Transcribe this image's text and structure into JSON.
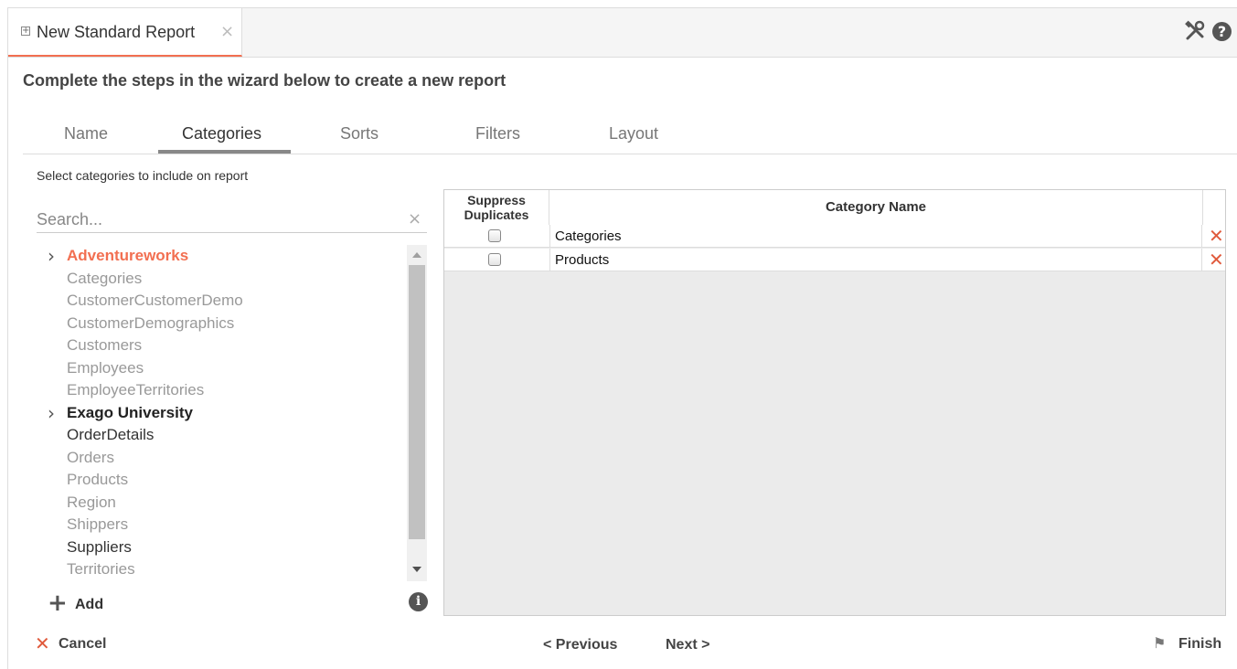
{
  "tab": {
    "title": "New Standard Report",
    "close": "×",
    "expand": "+"
  },
  "instructions": "Complete the steps in the wizard below to create a new report",
  "steps": [
    {
      "label": "Name",
      "active": false
    },
    {
      "label": "Categories",
      "active": true
    },
    {
      "label": "Sorts",
      "active": false
    },
    {
      "label": "Filters",
      "active": false
    },
    {
      "label": "Layout",
      "active": false
    }
  ],
  "select_label": "Select categories to include on report",
  "search": {
    "placeholder": "Search...",
    "clear": "×"
  },
  "tree": [
    {
      "label": "Adventureworks",
      "type": "group",
      "color": "#f26f51"
    },
    {
      "label": "Categories",
      "type": "item",
      "color": "#999999"
    },
    {
      "label": "CustomerCustomerDemo",
      "type": "item",
      "color": "#999999"
    },
    {
      "label": "CustomerDemographics",
      "type": "item",
      "color": "#999999"
    },
    {
      "label": "Customers",
      "type": "item",
      "color": "#999999"
    },
    {
      "label": "Employees",
      "type": "item",
      "color": "#999999"
    },
    {
      "label": "EmployeeTerritories",
      "type": "item",
      "color": "#999999"
    },
    {
      "label": "Exago University",
      "type": "group",
      "color": "#222222"
    },
    {
      "label": "OrderDetails",
      "type": "item",
      "color": "#333333"
    },
    {
      "label": "Orders",
      "type": "item",
      "color": "#999999"
    },
    {
      "label": "Products",
      "type": "item",
      "color": "#999999"
    },
    {
      "label": "Region",
      "type": "item",
      "color": "#999999"
    },
    {
      "label": "Shippers",
      "type": "item",
      "color": "#999999"
    },
    {
      "label": "Suppliers",
      "type": "item",
      "color": "#333333"
    },
    {
      "label": "Territories",
      "type": "item",
      "color": "#999999"
    }
  ],
  "add_label": "Add",
  "grid": {
    "headers": {
      "suppress": "Suppress Duplicates",
      "name": "Category Name"
    },
    "rows": [
      {
        "name": "Categories",
        "suppress": false
      },
      {
        "name": "Products",
        "suppress": false
      }
    ]
  },
  "footer": {
    "cancel": "Cancel",
    "previous": "Previous",
    "next": "Next",
    "finish": "Finish"
  },
  "colors": {
    "accent": "#f26f51",
    "delete": "#e05a3c"
  }
}
